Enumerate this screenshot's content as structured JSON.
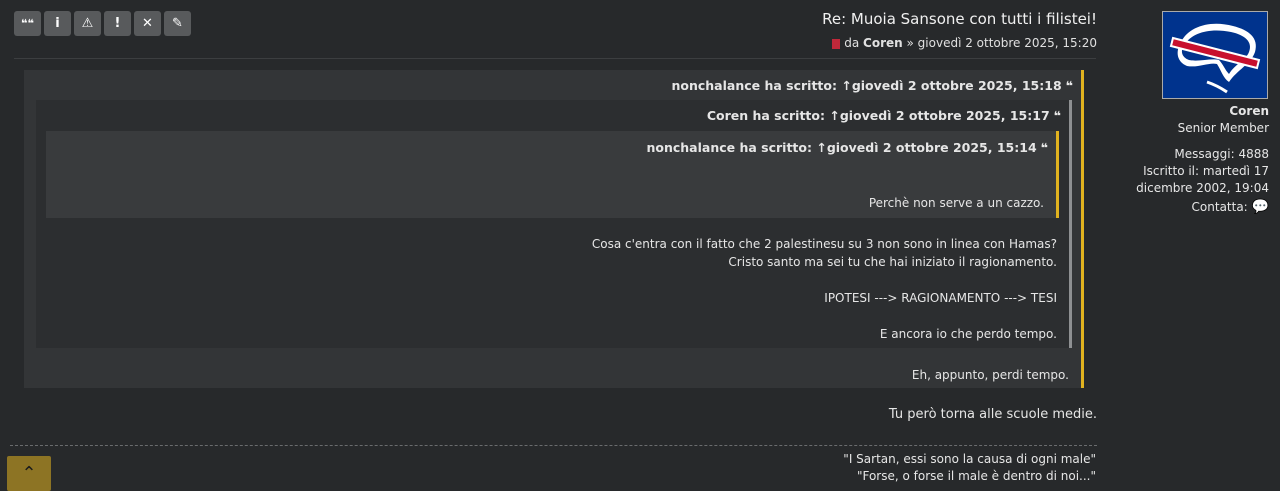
{
  "toolbar": {
    "buttons": [
      {
        "name": "quote-button",
        "glyph": "❝❝"
      },
      {
        "name": "info-button",
        "glyph": "i"
      },
      {
        "name": "report-button",
        "glyph": "⚠"
      },
      {
        "name": "warn-button",
        "glyph": "!"
      },
      {
        "name": "delete-button",
        "glyph": "✕"
      },
      {
        "name": "edit-button",
        "glyph": "✎"
      }
    ]
  },
  "post": {
    "title": "Re: Muoia Sansone con tutti i filistei!",
    "by_prefix": "da",
    "author": "Coren",
    "date_sep": "»",
    "date": "giovedì 2 ottobre 2025, 15:20",
    "quote1": {
      "cite": "nonchalance ha scritto: ↑giovedì 2 ottobre 2025, 15:18",
      "reply": "Eh, appunto, perdi tempo."
    },
    "quote2": {
      "cite": "Coren ha scritto: ↑giovedì 2 ottobre 2025, 15:17",
      "lines": [
        "Cosa c'entra con il fatto che 2 palestinesu su 3 non sono in linea con Hamas?",
        "Cristo santo ma sei tu che hai iniziato il ragionamento.",
        "IPOTESI ---> RAGIONAMENTO ---> TESI",
        "E ancora io che perdo tempo."
      ]
    },
    "quote3": {
      "cite": "nonchalance ha scritto: ↑giovedì 2 ottobre 2025, 15:14",
      "text": "Perchè non serve a un cazzo."
    },
    "body": "Tu però torna alle scuole medie.",
    "signature": [
      "\"I Sartan, essi sono la causa di ogni male\"",
      "\"Forse, o forse il male è dentro di noi...\""
    ]
  },
  "profile": {
    "username": "Coren",
    "rank": "Senior Member",
    "posts_label": "Messaggi:",
    "posts": "4888",
    "joined_label": "Iscritto il:",
    "joined_line1": "martedì 17",
    "joined_line2": "dicembre 2002, 19:04",
    "contact_label": "Contatta:"
  },
  "colors": {
    "accent": "#e1b21f",
    "background": "#27292b",
    "avatar_bg": "#00338d",
    "stripe": "#c8102e"
  }
}
